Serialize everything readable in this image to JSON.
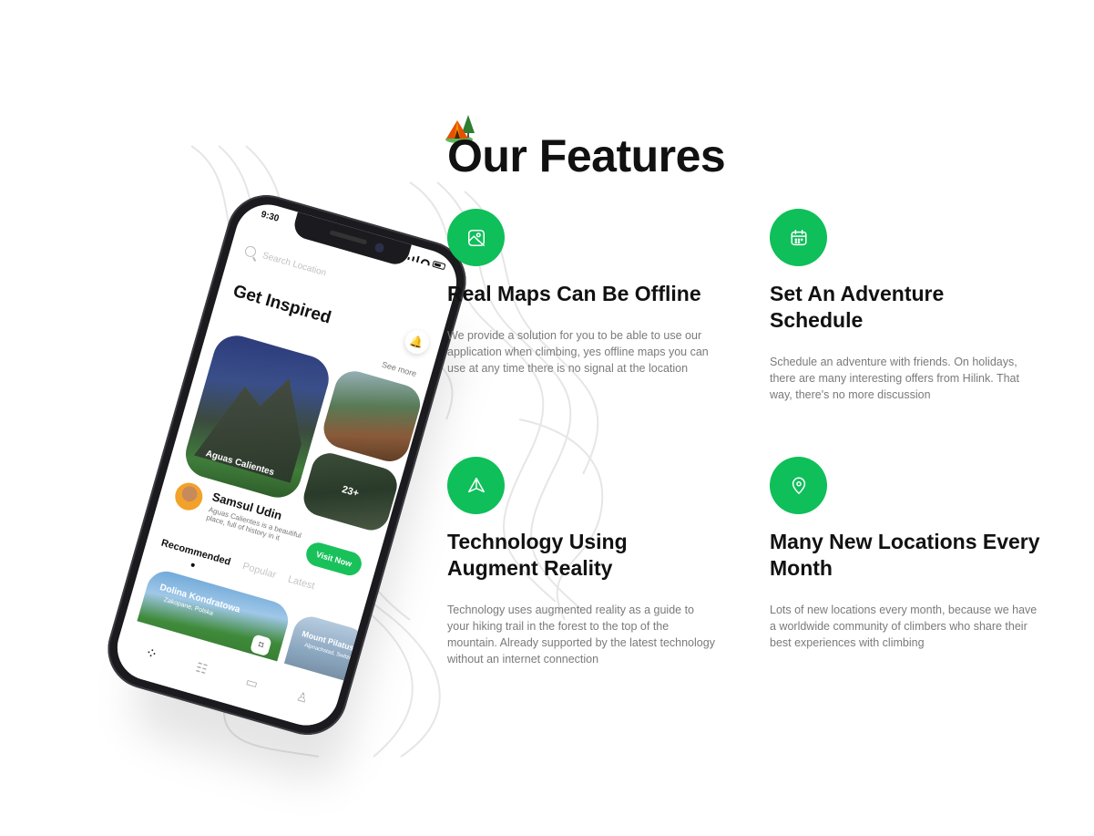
{
  "section": {
    "title": "Our Features",
    "features": [
      {
        "icon": "map-photo-icon",
        "heading": "Real Maps Can Be Offline",
        "description": "We provide a solution for you to be able to use our application when climbing, yes offline maps you can use at any time there is no signal at the location"
      },
      {
        "icon": "calendar-icon",
        "heading": "Set An Adventure Schedule",
        "description": "Schedule an adventure with friends. On holidays, there are many interesting offers from Hilink. That way, there's no more discussion"
      },
      {
        "icon": "compass-icon",
        "heading": "Technology Using Augment Reality",
        "description": "Technology uses augmented reality as a guide to your hiking trail in the forest to the top of the mountain. Already supported by the latest technology without an internet connection"
      },
      {
        "icon": "location-pin-icon",
        "heading": "Many New Locations Every Month",
        "description": "Lots of new locations every month, because we have a worldwide community of climbers who share their best experiences with climbing"
      }
    ]
  },
  "phone": {
    "time": "9:30",
    "search_placeholder": "Search Location",
    "heading": "Get Inspired",
    "see_more": "See more",
    "main_image_label": "Aguas Calientes",
    "more_count": "23+",
    "user_name": "Samsul Udin",
    "user_desc": "Aguas Calientes is a beautiful place, full of history in it",
    "visit_button": "Visit Now",
    "tabs": [
      "Recommended",
      "Popular",
      "Latest"
    ],
    "cards": [
      {
        "title": "Dolina Kondratowa",
        "subtitle": "Zakopane, Polska"
      },
      {
        "title": "Mount Pilatus",
        "subtitle": "Alpnachstad, Switzerland"
      }
    ]
  },
  "colors": {
    "accent": "#0fbf5a",
    "heading": "#111111",
    "body_text": "#7a7a7a"
  }
}
